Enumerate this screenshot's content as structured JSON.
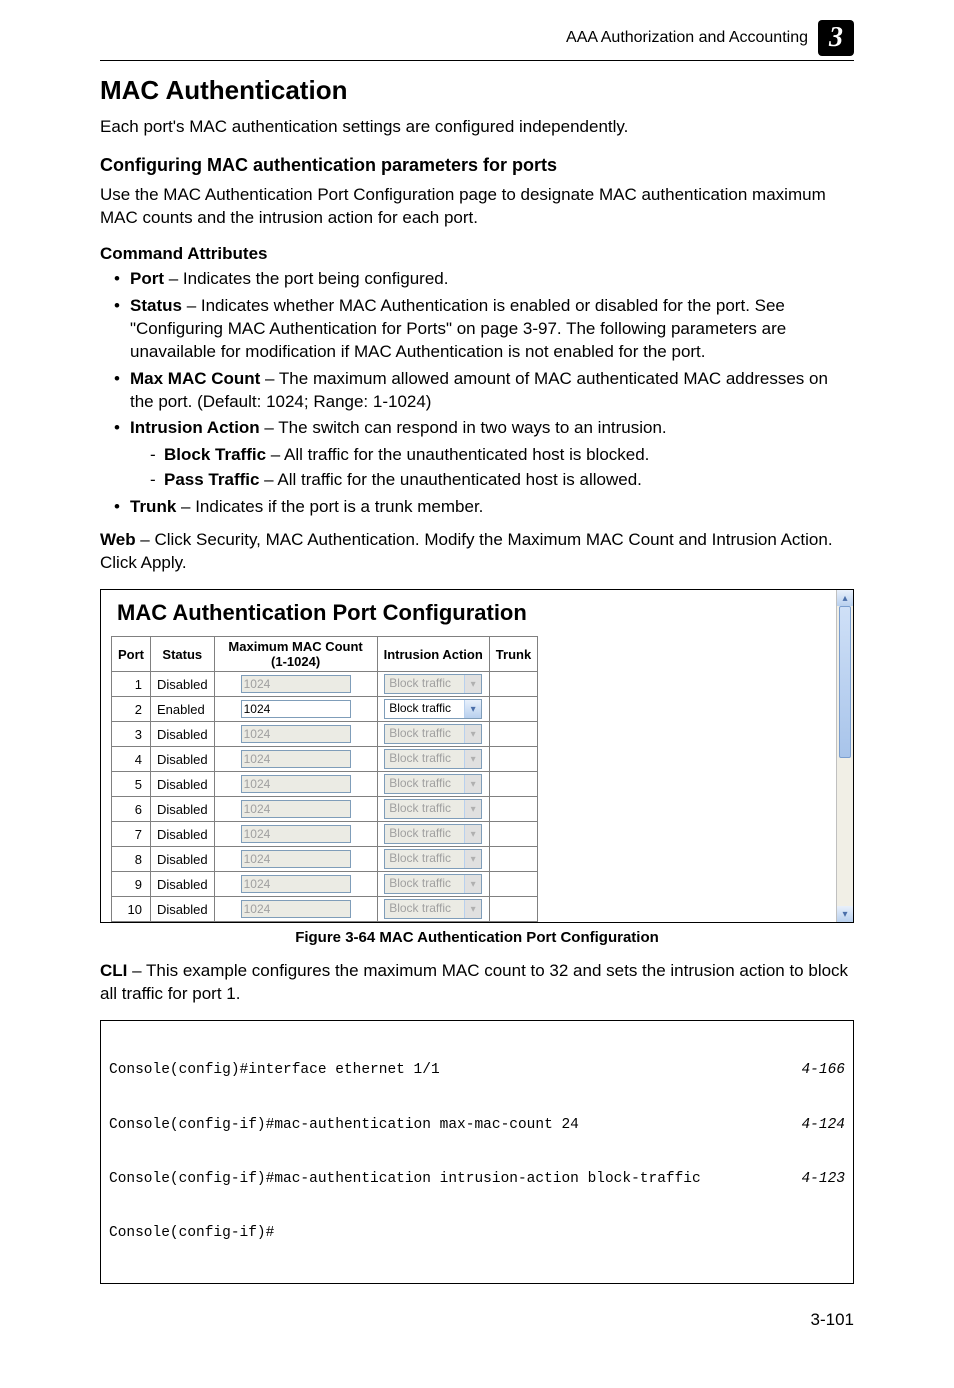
{
  "header": {
    "running_head": "AAA Authorization and Accounting",
    "chapter_number": "3"
  },
  "section_title": "MAC Authentication",
  "intro_para": "Each port's MAC authentication settings are configured independently.",
  "subhead": "Configuring MAC authentication parameters for ports",
  "subhead_para": "Use the MAC Authentication Port Configuration page to designate MAC authentication maximum MAC counts and the intrusion action for each port.",
  "cmd_attr_heading": "Command Attributes",
  "bullets": {
    "b0": {
      "term": "Port",
      "desc": " – Indicates the port being configured."
    },
    "b1": {
      "term": "Status",
      "desc": " – Indicates whether MAC Authentication is enabled or disabled for the port. See \"Configuring MAC Authentication for Ports\" on page 3-97. The following parameters are unavailable for modification if MAC Authentication is not enabled for the port."
    },
    "b2": {
      "term": "Max MAC Count",
      "desc": " – The maximum allowed amount of MAC authenticated MAC addresses on the port. (Default: 1024; Range: 1-1024)"
    },
    "b3": {
      "term": "Intrusion Action",
      "desc": " – The switch can respond in two ways to an intrusion."
    },
    "b3s0": {
      "term": "Block Traffic",
      "desc": " – All traffic for the unauthenticated host is blocked."
    },
    "b3s1": {
      "term": "Pass Traffic",
      "desc": " – All traffic for the unauthenticated host is allowed."
    },
    "b4": {
      "term": "Trunk",
      "desc": " – Indicates if the port is a trunk member."
    }
  },
  "web_para_lead": "Web",
  "web_para_rest": " – Click Security, MAC Authentication. Modify the Maximum MAC Count and Intrusion Action. Click Apply.",
  "figure": {
    "title": "MAC Authentication Port Configuration",
    "headers": {
      "port": "Port",
      "status": "Status",
      "max": "Maximum MAC Count (1-1024)",
      "intrusion": "Intrusion Action",
      "trunk": "Trunk"
    },
    "rows": [
      {
        "port": "1",
        "status": "Disabled",
        "max": "1024",
        "intrusion": "Block traffic",
        "enabled": false
      },
      {
        "port": "2",
        "status": "Enabled",
        "max": "1024",
        "intrusion": "Block traffic",
        "enabled": true
      },
      {
        "port": "3",
        "status": "Disabled",
        "max": "1024",
        "intrusion": "Block traffic",
        "enabled": false
      },
      {
        "port": "4",
        "status": "Disabled",
        "max": "1024",
        "intrusion": "Block traffic",
        "enabled": false
      },
      {
        "port": "5",
        "status": "Disabled",
        "max": "1024",
        "intrusion": "Block traffic",
        "enabled": false
      },
      {
        "port": "6",
        "status": "Disabled",
        "max": "1024",
        "intrusion": "Block traffic",
        "enabled": false
      },
      {
        "port": "7",
        "status": "Disabled",
        "max": "1024",
        "intrusion": "Block traffic",
        "enabled": false
      },
      {
        "port": "8",
        "status": "Disabled",
        "max": "1024",
        "intrusion": "Block traffic",
        "enabled": false
      },
      {
        "port": "9",
        "status": "Disabled",
        "max": "1024",
        "intrusion": "Block traffic",
        "enabled": false
      },
      {
        "port": "10",
        "status": "Disabled",
        "max": "1024",
        "intrusion": "Block traffic",
        "enabled": false
      }
    ],
    "caption": "Figure 3-64  MAC Authentication Port Configuration"
  },
  "cli_para_lead": "CLI",
  "cli_para_rest": " – This example configures the maximum MAC count to 32 and sets the intrusion action to block all traffic for port 1.",
  "cli": {
    "l0": {
      "cmd": "Console(config)#interface ethernet 1/1",
      "ref": "4-166"
    },
    "l1": {
      "cmd": "Console(config-if)#mac-authentication max-mac-count 24",
      "ref": "4-124"
    },
    "l2": {
      "cmd": "Console(config-if)#mac-authentication intrusion-action block-traffic",
      "ref": "4-123"
    },
    "l3": {
      "cmd": "Console(config-if)#",
      "ref": ""
    }
  },
  "page_number": "3-101"
}
